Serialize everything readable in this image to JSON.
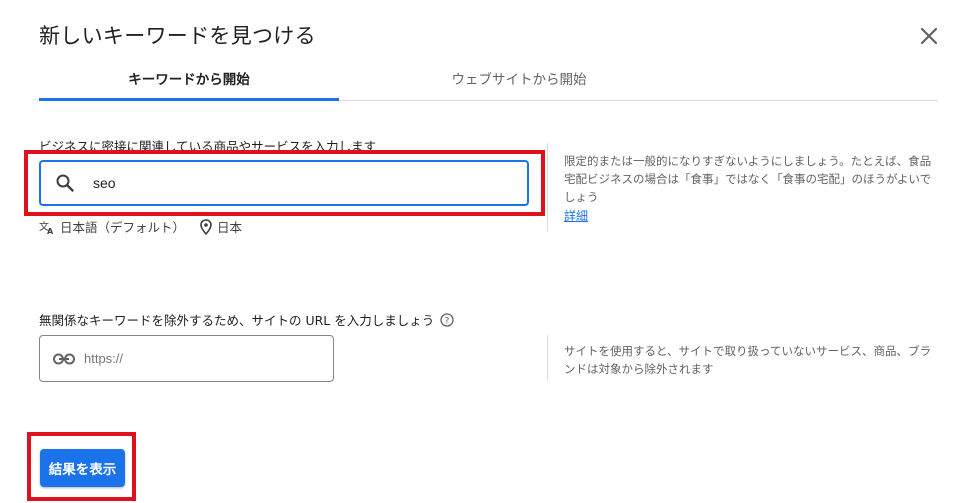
{
  "dialog": {
    "title": "新しいキーワードを見つける",
    "close_icon": "close-icon"
  },
  "tabs": [
    {
      "label": "キーワードから開始",
      "active": true
    },
    {
      "label": "ウェブサイトから開始",
      "active": false
    }
  ],
  "keyword_section": {
    "label": "ビジネスに密接に関連している商品やサービスを入力します",
    "input_value": "seo",
    "search_icon": "search-icon",
    "language_icon": "translate-icon",
    "language": "日本語（デフォルト）",
    "location_icon": "location-pin-icon",
    "location": "日本",
    "hint": "限定的または一般的になりすぎないようにしましょう。たとえば、食品宅配ビジネスの場合は「食事」ではなく「食事の宅配」のほうがよいでしょう",
    "hint_link": "詳細"
  },
  "url_section": {
    "label": "無関係なキーワードを除外するため、サイトの URL を入力しましょう",
    "help_icon": "help-circle-icon",
    "link_icon": "link-icon",
    "placeholder": "https://",
    "hint": "サイトを使用すると、サイトで取り扱っていないサービス、商品、ブランドは対象から除外されます"
  },
  "actions": {
    "submit_label": "結果を表示"
  },
  "colors": {
    "accent": "#1a73e8",
    "highlight": "#e0101e",
    "divider": "#dadce0"
  }
}
